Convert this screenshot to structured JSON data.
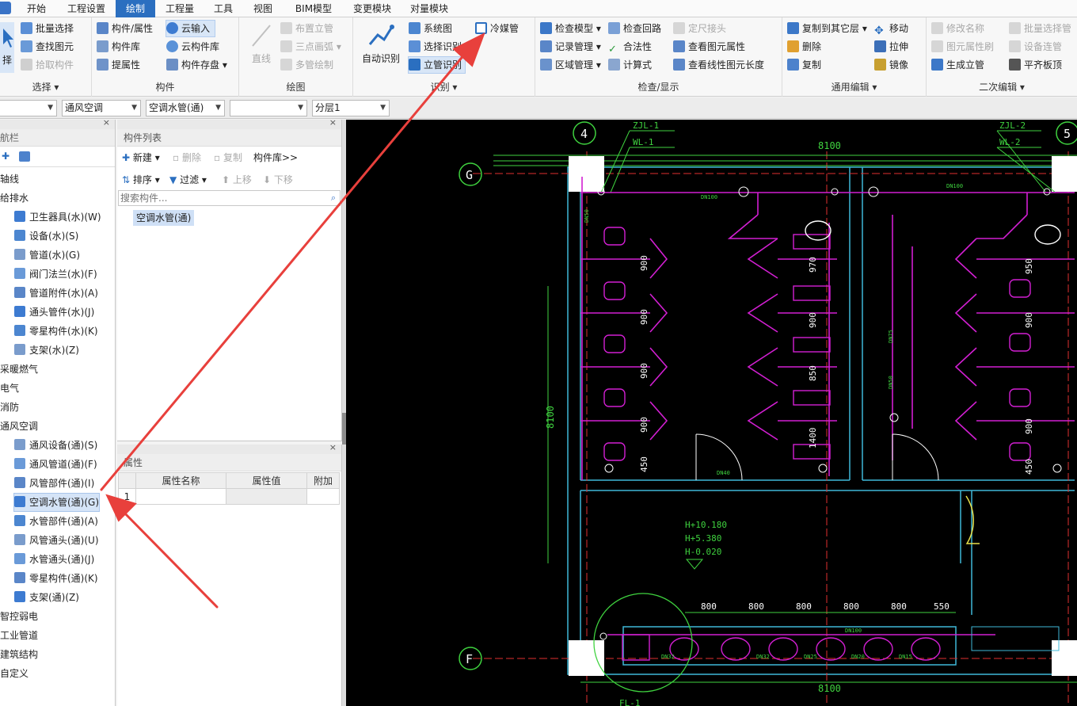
{
  "menu": {
    "tabs": [
      "开始",
      "工程设置",
      "绘制",
      "工程量",
      "工具",
      "视图",
      "BIM模型",
      "变更模块",
      "对量模块"
    ],
    "active": "绘制"
  },
  "ribbon": {
    "select_group": {
      "label": "选择",
      "big_button": "择",
      "batch_select": "批量选择",
      "find_element": "查找图元",
      "pick_component": "拾取构件"
    },
    "component_group": {
      "label": "构件",
      "component_attr": "构件/属性",
      "component_lib": "构件库",
      "extract_attr": "提属性",
      "cloud_input": "云输入",
      "cloud_lib": "云构件库",
      "component_save": "构件存盘"
    },
    "draw_group": {
      "label": "绘图",
      "line": "直线",
      "place_riser": "布置立管",
      "three_point_arc": "三点画弧",
      "multi_pipe_draw": "多管绘制"
    },
    "identify_group": {
      "label": "识别",
      "auto_identify": "自动识别",
      "system_diagram": "系统图",
      "select_identify": "选择识别",
      "riser_identify": "立管识别",
      "refrigerant_pipe": "冷媒管"
    },
    "check_group": {
      "label": "检查/显示",
      "check_model": "检查模型",
      "record_mgmt": "记录管理",
      "area_mgmt": "区域管理",
      "check_loop": "检查回路",
      "legality": "合法性",
      "formula": "计算式",
      "fixed_joint": "定尺接头",
      "view_element_attr": "查看图元属性",
      "view_linear_length": "查看线性图元长度"
    },
    "edit_group": {
      "label": "通用编辑",
      "copy_to_layer": "复制到其它层",
      "delete": "删除",
      "copy": "复制",
      "move": "移动",
      "stretch": "拉伸",
      "mirror": "镜像"
    },
    "secondary_group": {
      "label": "二次编辑",
      "rename": "修改名称",
      "element_attr_brush": "图元属性刷",
      "create_riser": "生成立管",
      "batch_select_pipe": "批量选择管",
      "device_connect": "设备连管",
      "flush_top": "平齐板顶"
    }
  },
  "combos": {
    "c1": "",
    "c2": "通风空调",
    "c3": "空调水管(通)",
    "c4": "",
    "c5": "分层1"
  },
  "nav": {
    "title": "航栏",
    "items": [
      {
        "label": "轴线",
        "sub": false
      },
      {
        "label": "给排水",
        "sub": false
      },
      {
        "label": "卫生器具(水)(W)",
        "sub": true,
        "icon": "sanitary-fixture-icon"
      },
      {
        "label": "设备(水)(S)",
        "sub": true,
        "icon": "equipment-icon"
      },
      {
        "label": "管道(水)(G)",
        "sub": true,
        "icon": "pipe-icon"
      },
      {
        "label": "阀门法兰(水)(F)",
        "sub": true,
        "icon": "valve-flange-icon"
      },
      {
        "label": "管道附件(水)(A)",
        "sub": true,
        "icon": "pipe-accessory-icon"
      },
      {
        "label": "通头管件(水)(J)",
        "sub": true,
        "icon": "pipe-fitting-icon"
      },
      {
        "label": "零星构件(水)(K)",
        "sub": true,
        "icon": "misc-component-icon"
      },
      {
        "label": "支架(水)(Z)",
        "sub": true,
        "icon": "support-icon"
      },
      {
        "label": "采暖燃气",
        "sub": false
      },
      {
        "label": "电气",
        "sub": false
      },
      {
        "label": "消防",
        "sub": false
      },
      {
        "label": "通风空调",
        "sub": false
      },
      {
        "label": "通风设备(通)(S)",
        "sub": true,
        "icon": "ventilation-equipment-icon"
      },
      {
        "label": "通风管道(通)(F)",
        "sub": true,
        "icon": "air-duct-icon"
      },
      {
        "label": "风管部件(通)(I)",
        "sub": true,
        "icon": "duct-component-icon"
      },
      {
        "label": "空调水管(通)(G)",
        "sub": true,
        "icon": "ac-water-pipe-icon",
        "selected": true
      },
      {
        "label": "水管部件(通)(A)",
        "sub": true,
        "icon": "water-pipe-component-icon"
      },
      {
        "label": "风管通头(通)(U)",
        "sub": true,
        "icon": "duct-fitting-icon"
      },
      {
        "label": "水管通头(通)(J)",
        "sub": true,
        "icon": "water-pipe-fitting-icon"
      },
      {
        "label": "零星构件(通)(K)",
        "sub": true,
        "icon": "misc-component-icon"
      },
      {
        "label": "支架(通)(Z)",
        "sub": true,
        "icon": "support-icon"
      },
      {
        "label": "智控弱电",
        "sub": false
      },
      {
        "label": "工业管道",
        "sub": false
      },
      {
        "label": "建筑结构",
        "sub": false
      },
      {
        "label": "自定义",
        "sub": false
      }
    ]
  },
  "component_list": {
    "title": "构件列表",
    "new": "新建",
    "delete": "删除",
    "copy": "复制",
    "library": "构件库>>",
    "sort": "排序",
    "filter": "过滤",
    "move_up": "上移",
    "move_down": "下移",
    "search_placeholder": "搜索构件...",
    "items": [
      "空调水管(通)"
    ]
  },
  "properties": {
    "title": "属性",
    "columns": [
      "属性名称",
      "属性值",
      "附加"
    ],
    "rows": [
      {
        "index": "1",
        "name": "",
        "value": "",
        "extra": ""
      }
    ]
  },
  "drawing": {
    "axis_labels": [
      "4",
      "5",
      "G",
      "F"
    ],
    "pipe_tags": [
      "ZJL-1",
      "WL-1",
      "ZJL-2",
      "WL-2",
      "FL-1"
    ],
    "dimension_top": "8100",
    "dimension_bottom": "8100",
    "dimension_side": "8100",
    "stall_dims": [
      "900",
      "900",
      "900",
      "900",
      "450",
      "970",
      "900",
      "850",
      "1400",
      "950",
      "900",
      "900",
      "450"
    ],
    "sink_dims": [
      "800",
      "800",
      "800",
      "800",
      "800",
      "550"
    ],
    "elevations": [
      "H+10.180",
      "H+5.380",
      "H-0.020"
    ],
    "pipe_sizes": [
      "DN100",
      "DN100",
      "DN50",
      "DN40",
      "DN75",
      "DN50",
      "DN100",
      "DN32",
      "DN32",
      "DN25",
      "DN20",
      "DN15"
    ]
  },
  "colors": {
    "accent": "#2b6fc0",
    "annotation_arrow": "#e8403c",
    "cad_magenta": "#d21fd2",
    "cad_green": "#3fd23f",
    "cad_cyan": "#3fb8d8",
    "cad_red": "#e03030"
  }
}
